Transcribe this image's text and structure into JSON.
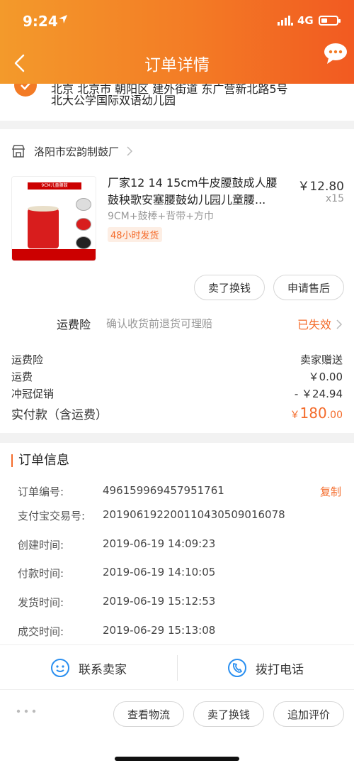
{
  "status_bar": {
    "time": "9:24",
    "network": "4G"
  },
  "nav": {
    "title": "订单详情"
  },
  "address": {
    "line1": "北京 北京市 朝阳区 建外街道 东广营新北路5号",
    "line2": "北大公学国际双语幼儿园"
  },
  "shop": {
    "name": "洛阳市宏韵制鼓厂"
  },
  "product": {
    "title_line1": "厂家12 14 15cm牛皮腰鼓成人腰",
    "title_line2": "鼓秧歌安塞腰鼓幼儿园儿童腰...",
    "price": "￥12.80",
    "quantity": "x15",
    "spec": "9CM+鼓棒+背带+方巾",
    "tag": "48小时发货",
    "thumb_text": "9CM儿童腰鼓"
  },
  "item_actions": {
    "sell": "卖了换钱",
    "after_sale": "申请售后"
  },
  "insurance": {
    "label": "运费险",
    "desc": "确认收货前退货可理赔",
    "status": "已失效"
  },
  "fees": [
    {
      "label": "运费险",
      "value": "卖家赠送"
    },
    {
      "label": "运费",
      "value": "￥0.00"
    },
    {
      "label": "冲冠促销",
      "value": "- ￥24.94"
    }
  ],
  "total": {
    "label": "实付款（含运费）",
    "currency": "￥",
    "integer": "180",
    "decimal": ".00"
  },
  "order_info": {
    "title": "订单信息",
    "copy": "复制",
    "rows": [
      {
        "label": "订单编号:",
        "value": "496159969457951761"
      },
      {
        "label": "支付宝交易号:",
        "value": "2019061922001104305090160​78"
      },
      {
        "label": "创建时间:",
        "value": "2019-06-19 14:09:23"
      },
      {
        "label": "付款时间:",
        "value": "2019-06-19 14:10:05"
      },
      {
        "label": "发货时间:",
        "value": "2019-06-19 15:12:53"
      },
      {
        "label": "成交时间:",
        "value": "2019-06-29 15:13:08"
      }
    ]
  },
  "contact": {
    "seller": "联系卖家",
    "call": "拨打电话"
  },
  "bottom_actions": {
    "logistics": "查看物流",
    "sell": "卖了换钱",
    "review": "追加评价"
  },
  "colors": {
    "accent": "#f46b2a",
    "header_start": "#f39a2b",
    "header_end": "#f25a21"
  }
}
